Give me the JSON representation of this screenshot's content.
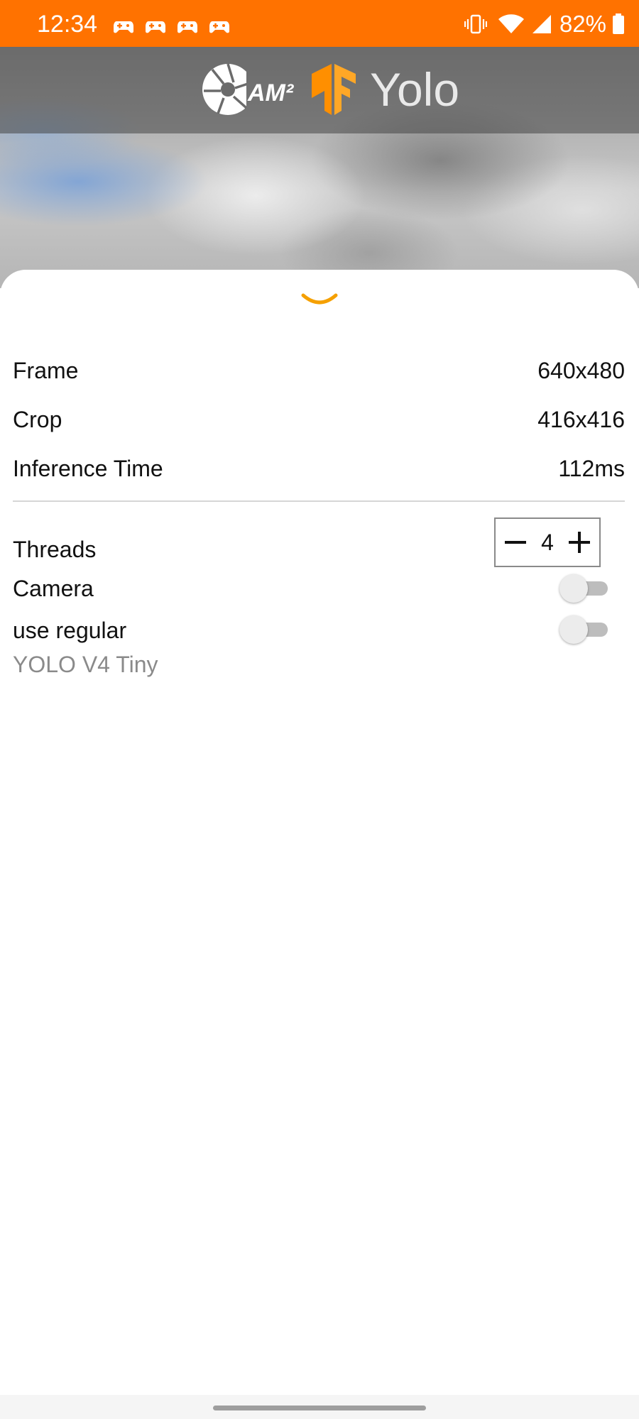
{
  "status_bar": {
    "time": "12:34",
    "battery_percent": "82%",
    "background_color": "#ff7200",
    "notification_icons": [
      "game-controller-icon",
      "game-controller-icon",
      "game-controller-icon",
      "game-controller-icon"
    ],
    "system_icons": [
      "vibrate-icon",
      "wifi-icon",
      "signal-icon",
      "battery-icon"
    ]
  },
  "header": {
    "logo_text": "AM²",
    "title": "Yolo",
    "brand_color": "#ff8f00"
  },
  "bottom_sheet": {
    "collapse_icon": "chevron-down-icon",
    "stats": [
      {
        "label": "Frame",
        "value": "640x480"
      },
      {
        "label": "Crop",
        "value": "416x416"
      },
      {
        "label": "Inference Time",
        "value": "112ms"
      }
    ],
    "threads": {
      "label": "Threads",
      "value": "4",
      "minus_icon": "minus-icon",
      "plus_icon": "plus-icon"
    },
    "camera": {
      "label": "Camera",
      "enabled": false
    },
    "use_regular": {
      "label": "use regular",
      "enabled": false
    },
    "model_name": "YOLO V4 Tiny"
  }
}
